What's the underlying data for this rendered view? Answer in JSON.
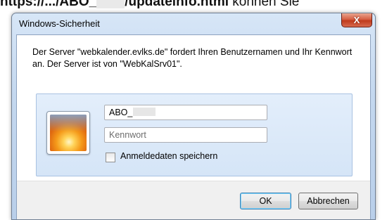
{
  "background_page": {
    "text_bold": "https://.../ABO_",
    "text_bold_suffix": "/updateinfo.html",
    "text_normal": " können Sie"
  },
  "window": {
    "title": "Windows-Sicherheit",
    "close_glyph": "X"
  },
  "message": "Der Server \"webkalender.evlks.de\" fordert Ihren Benutzernamen und Ihr Kennwort an. Der Server ist von \"WebKalSrv01\".",
  "credentials": {
    "avatar_icon": "user-flower-avatar",
    "username_value": "ABO_",
    "password_placeholder": "Kennwort",
    "remember_label": "Anmeldedaten speichern",
    "remember_checked": false
  },
  "buttons": {
    "ok_label": "OK",
    "cancel_label": "Abbrechen"
  },
  "colors": {
    "title_bar": "#c4d8ef",
    "close_button": "#d65f43",
    "panel": "#dce9f8"
  }
}
